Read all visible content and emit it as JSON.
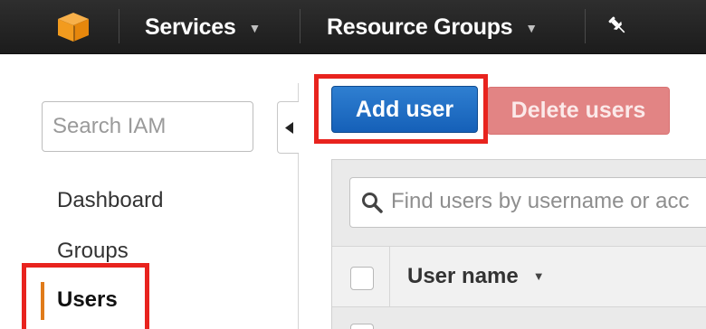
{
  "topbar": {
    "logo_icon": "aws-cube-icon",
    "services_label": "Services",
    "resource_groups_label": "Resource Groups",
    "pin_icon": "pin-icon",
    "caret_icon": "chevron-down-icon"
  },
  "sidebar": {
    "search_placeholder": "Search IAM",
    "items": [
      {
        "label": "Dashboard",
        "active": false
      },
      {
        "label": "Groups",
        "active": false
      },
      {
        "label": "Users",
        "active": true
      }
    ],
    "active_accent": "#e07b1a"
  },
  "toolbar": {
    "add_user_label": "Add user",
    "delete_users_label": "Delete users",
    "primary_color": "#1f6fc5",
    "disabled_color": "#e28484"
  },
  "users_table": {
    "filter_placeholder": "Find users by username or acc",
    "columns": [
      {
        "label": "User name",
        "sortable": true
      }
    ]
  },
  "annotations": {
    "highlight_color": "#e8231e"
  }
}
